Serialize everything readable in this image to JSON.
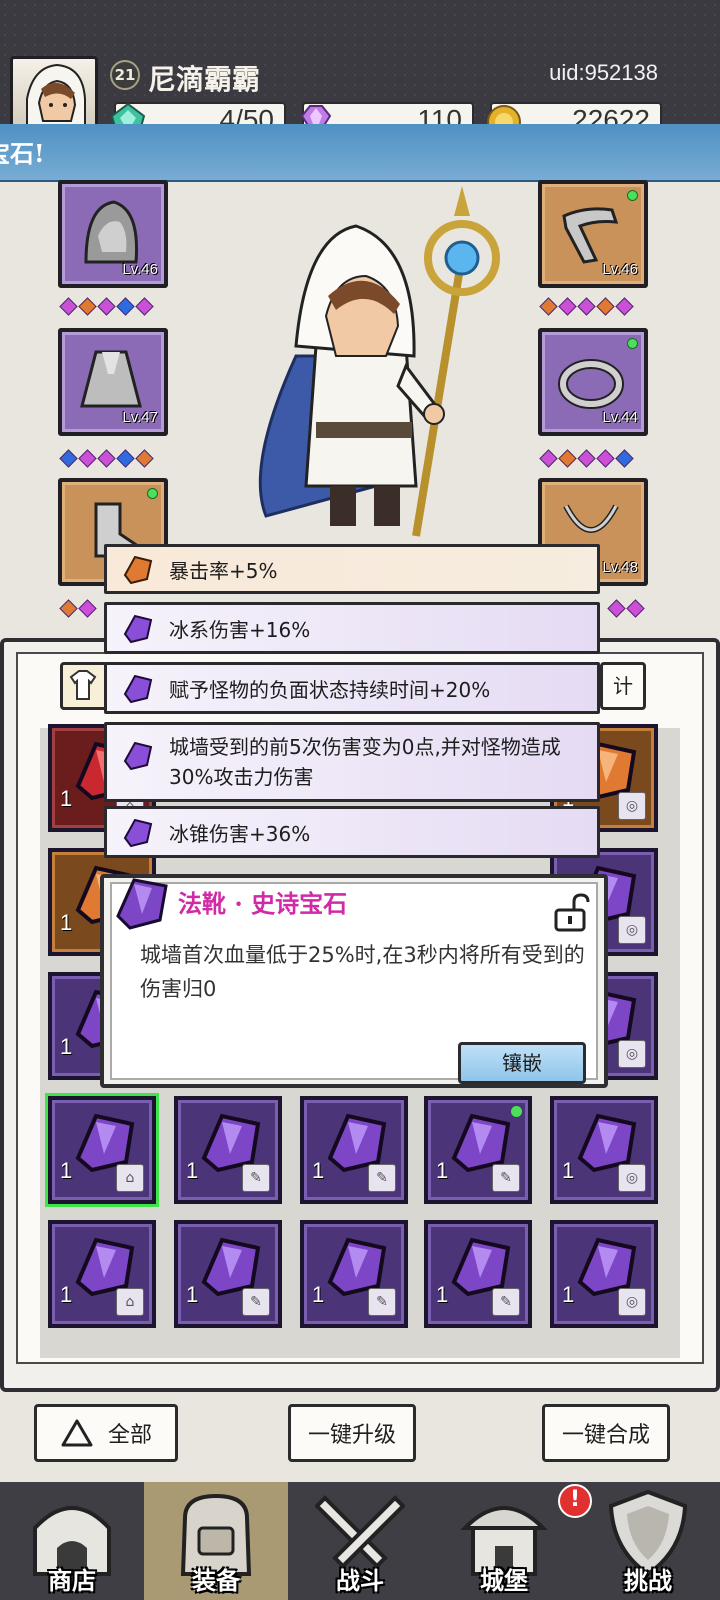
{
  "player": {
    "level": "21",
    "name": "尼滴霸霸",
    "uid": "uid:952138"
  },
  "resources": {
    "energy": "4/50",
    "gems": "110",
    "gold": "22622"
  },
  "banner": {
    "text": "宝石!"
  },
  "equipment": {
    "left": [
      {
        "name": "hood",
        "level": "Lv.46"
      },
      {
        "name": "cloak",
        "level": "Lv.47"
      },
      {
        "name": "boots",
        "level": "Lv."
      }
    ],
    "right": [
      {
        "name": "staff",
        "level": "Lv.46"
      },
      {
        "name": "ring",
        "level": "Lv.44"
      },
      {
        "name": "necklace",
        "level": "Lv.48"
      }
    ]
  },
  "attributes": [
    "暴击率+5%",
    "冰系伤害+16%",
    "赋予怪物的负面状态持续时间+20%",
    "城墙受到的前5次伤害变为0点,并对怪物造成30%攻击力伤害",
    "冰锥伤害+36%"
  ],
  "tab_right_label": "计",
  "gem_detail": {
    "title": "法靴 · 史诗宝石",
    "description": "城墙首次血量低于25%时,在3秒内将所有受到的伤害归0",
    "inlay_button": "镶嵌"
  },
  "gem_grid": {
    "qty": "1",
    "rows": [
      [
        "red",
        "",
        "",
        "",
        "amber"
      ],
      [
        "amber",
        "",
        "",
        "",
        "purple"
      ],
      [
        "purple",
        "",
        "",
        "",
        "purple"
      ],
      [
        "purple",
        "purple",
        "purple",
        "purple",
        "purple"
      ],
      [
        "purple",
        "purple",
        "purple",
        "purple",
        "purple"
      ]
    ]
  },
  "actions": {
    "all": "全部",
    "upgrade_all": "一键升级",
    "merge_all": "一键合成"
  },
  "nav": {
    "shop": "商店",
    "equip": "装备",
    "battle": "战斗",
    "castle": "城堡",
    "challenge": "挑战",
    "alert": "!"
  },
  "colors": {
    "epic_purple": "#8b6bb5",
    "orange_quality": "#c9925a",
    "banner_blue": "#4f91c2",
    "title_magenta": "#d12aa6"
  }
}
